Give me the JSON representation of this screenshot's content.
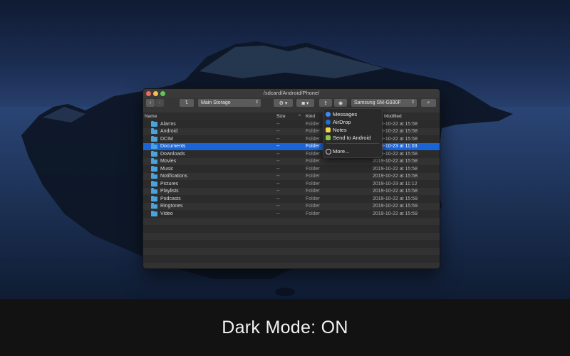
{
  "window": {
    "title": "/sdcard/Android/Phone/"
  },
  "toolbar": {
    "back_icon": "chevron-left-icon",
    "forward_icon": "chevron-right-icon",
    "up_icon": "enclosing-folder-icon",
    "storage_select": "Main Storage",
    "gear_icon": "gear-icon",
    "camera_icon": "camera-icon",
    "share_icon": "share-icon",
    "device_select": "Samsung SM-G930F",
    "search_icon": "search-icon"
  },
  "columns": {
    "name": "Name",
    "size": "Size",
    "kind": "Kind",
    "modified": "Modified"
  },
  "files": [
    {
      "name": "Alarms",
      "size": "--",
      "kind": "Folder",
      "modified": "2019-10-22 at 15:58"
    },
    {
      "name": "Android",
      "size": "--",
      "kind": "Folder",
      "modified": "2019-10-22 at 15:58"
    },
    {
      "name": "DCIM",
      "size": "--",
      "kind": "Folder",
      "modified": "2019-10-22 at 15:58"
    },
    {
      "name": "Documents",
      "size": "--",
      "kind": "Folder",
      "modified": "2019-10-23 at 11:03"
    },
    {
      "name": "Downloads",
      "size": "--",
      "kind": "Folder",
      "modified": "2019-10-22 at 15:58"
    },
    {
      "name": "Movies",
      "size": "--",
      "kind": "Folder",
      "modified": "2019-10-22 at 15:58"
    },
    {
      "name": "Music",
      "size": "--",
      "kind": "Folder",
      "modified": "2019-10-22 at 15:58"
    },
    {
      "name": "Notifications",
      "size": "--",
      "kind": "Folder",
      "modified": "2019-10-22 at 15:58"
    },
    {
      "name": "Pictures",
      "size": "--",
      "kind": "Folder",
      "modified": "2019-10-23 at 11:12"
    },
    {
      "name": "Playlists",
      "size": "--",
      "kind": "Folder",
      "modified": "2019-10-22 at 15:58"
    },
    {
      "name": "Podcasts",
      "size": "--",
      "kind": "Folder",
      "modified": "2019-10-22 at 15:59"
    },
    {
      "name": "Ringtones",
      "size": "--",
      "kind": "Folder",
      "modified": "2019-10-22 at 15:59"
    },
    {
      "name": "Video",
      "size": "--",
      "kind": "Folder",
      "modified": "2019-10-22 at 15:59"
    }
  ],
  "selected_row": "Documents",
  "share_menu": {
    "items": [
      {
        "label": "Messages",
        "icon": "messages-icon"
      },
      {
        "label": "AirDrop",
        "icon": "airdrop-icon"
      },
      {
        "label": "Notes",
        "icon": "notes-icon"
      },
      {
        "label": "Send to Android",
        "icon": "android-icon"
      }
    ],
    "more": {
      "label": "More...",
      "icon": "more-icon"
    }
  },
  "caption": "Dark Mode: ON",
  "colors": {
    "selection": "#1a64d6",
    "folder": "#4aa3dd",
    "close": "#ed6a5e",
    "minimize": "#f5be4f",
    "maximize": "#62c655"
  }
}
